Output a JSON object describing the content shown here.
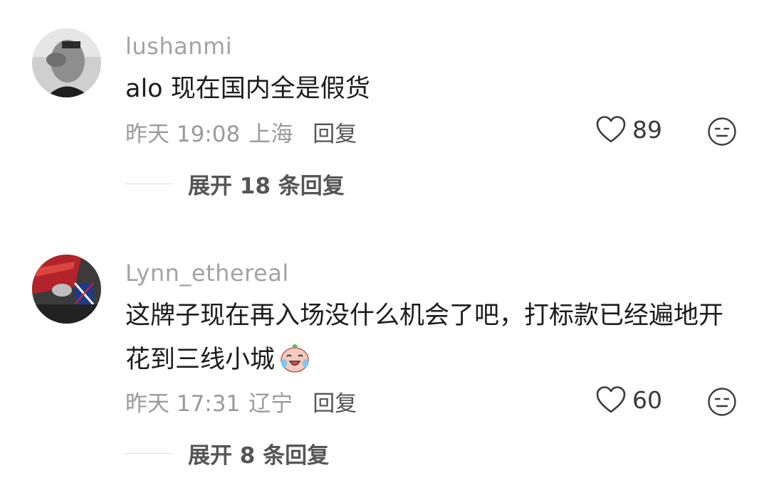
{
  "comments": [
    {
      "username": "lushanmi",
      "text": "alo 现在国内全是假货",
      "time": "昨天 19:08",
      "location": "上海",
      "reply_label": "回复",
      "likes": "89",
      "expand_label": "展开 18 条回复"
    },
    {
      "username": "Lynn_ethereal",
      "text": "这牌子现在再入场没什么机会了吧，打标款已经遍地开花到三线小城",
      "time": "昨天 17:31",
      "location": "辽宁",
      "reply_label": "回复",
      "likes": "60",
      "expand_label": "展开 8 条回复",
      "trailing_emoji": "crying-laughing-peach-emoji"
    }
  ],
  "colors": {
    "username": "#a3a3a3",
    "body_text": "#1c1c1c",
    "meta": "#9a9a9a",
    "action_text": "#555555"
  }
}
